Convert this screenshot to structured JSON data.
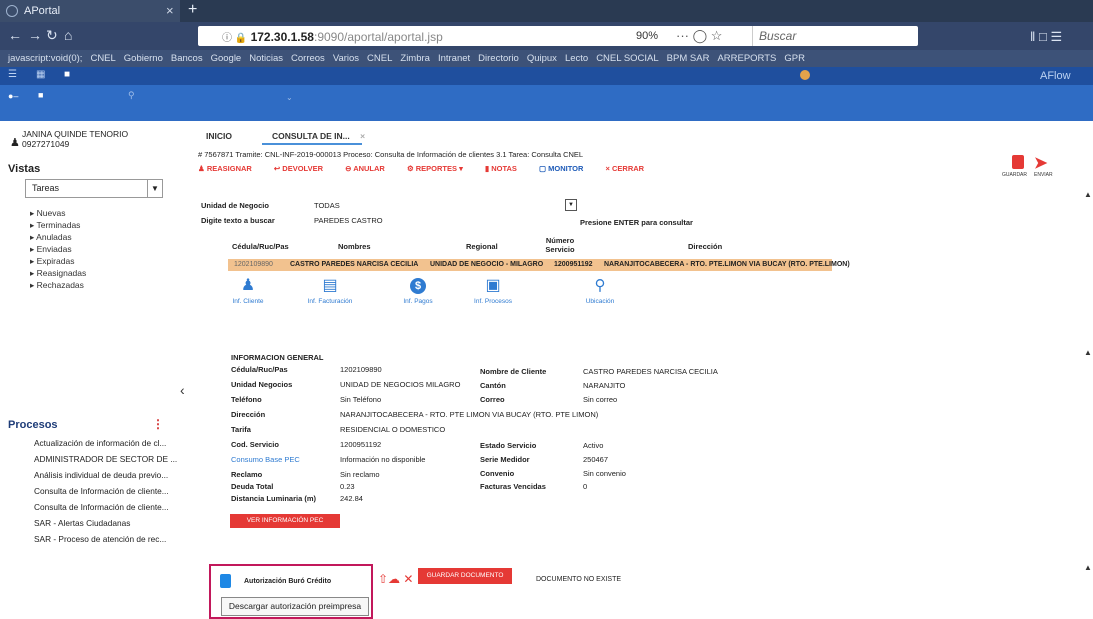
{
  "browser": {
    "tab_title": "APortal",
    "tab_close": "×",
    "new_tab": "+",
    "url_host": "172.30.1.58",
    "url_rest": ":9090/aportal/aportal.jsp",
    "zoom": "90%",
    "search_placeholder": "Buscar",
    "bookmarks": [
      "javascript:void(0);",
      "CNEL",
      "Gobierno",
      "Bancos",
      "Google",
      "Noticias",
      "Correos",
      "Varios",
      "CNEL",
      "Zimbra",
      "Intranet",
      "Directorio",
      "Quipux",
      "Lecto",
      "CNEL SOCIAL",
      "BPM SAR",
      "ARREPORTS",
      "GPR"
    ]
  },
  "app": {
    "brand": "AFlow"
  },
  "sidebar": {
    "user_name": "JANINA QUINDE TENORIO",
    "user_id": "0927271049",
    "vistas_title": "Vistas",
    "vistas_select": "Tareas",
    "vistas_items": [
      "Nuevas",
      "Terminadas",
      "Anuladas",
      "Enviadas",
      "Expiradas",
      "Reasignadas",
      "Rechazadas"
    ],
    "procesos_title": "Procesos",
    "procesos_items": [
      "Actualización de información de cl...",
      "ADMINISTRADOR DE SECTOR DE ...",
      "Análisis individual de deuda previo...",
      "Consulta de Información de cliente...",
      "Consulta de Información de cliente...",
      "SAR - Alertas Ciudadanas",
      "SAR - Proceso de atención de rec..."
    ]
  },
  "main": {
    "tab_inicio": "INICIO",
    "tab_consulta": "CONSULTA DE IN...",
    "tab_close": "×",
    "ticket": "# 7567871 Tramite: CNL-INF-2019-000013 Proceso: Consulta de Información de clientes 3.1 Tarea: Consulta CNEL",
    "actions": [
      "REASIGNAR",
      "DEVOLVER",
      "ANULAR",
      "REPORTES ▾",
      "NOTAS",
      "MONITOR",
      "CERRAR"
    ],
    "save_label": "GUARDAR",
    "send_label": "ENVIAR",
    "unidad_label": "Unidad de Negocio",
    "unidad_value": "TODAS",
    "digite_label": "Digite texto a buscar",
    "digite_value": "PAREDES CASTRO",
    "enter_hint": "Presione ENTER para consultar",
    "table_headers": [
      "Cédula/Ruc/Pas",
      "Nombres",
      "Regional",
      "Número Servicio",
      "Dirección"
    ],
    "table_row": [
      "1202109890",
      "CASTRO PAREDES NARCISA CECILIA",
      "UNIDAD DE NEGOCIO - MILAGRO",
      "1200951192",
      "NARANJITOCABECERA - RTO. PTE.LIMON VIA BUCAY (RTO. PTE.LIMON)"
    ],
    "tools": [
      "Inf. Cliente",
      "Inf. Facturación",
      "Inf. Pagos",
      "Inf. Procesos",
      "Ubicación"
    ],
    "info_title": "INFORMACION GENERAL",
    "info_left": [
      {
        "k": "Cédula/Ruc/Pas",
        "v": "1202109890"
      },
      {
        "k": "Unidad Negocios",
        "v": "UNIDAD DE NEGOCIOS MILAGRO"
      },
      {
        "k": "Teléfono",
        "v": "Sin Teléfono"
      },
      {
        "k": "Dirección",
        "v": "NARANJITOCABECERA - RTO. PTE LIMON VIA BUCAY (RTO. PTE LIMON)"
      },
      {
        "k": "Tarifa",
        "v": "RESIDENCIAL O DOMESTICO"
      },
      {
        "k": "Cod. Servicio",
        "v": "1200951192"
      },
      {
        "k": "Consumo Base PEC",
        "v": "Información no disponible"
      },
      {
        "k": "Reclamo",
        "v": "Sin reclamo"
      },
      {
        "k": "Deuda Total",
        "v": "0.23"
      },
      {
        "k": "Distancia Luminaria (m)",
        "v": "242.84"
      }
    ],
    "info_right": [
      {
        "k": "Nombre de Cliente",
        "v": "CASTRO PAREDES NARCISA CECILIA"
      },
      {
        "k": "Cantón",
        "v": "NARANJITO"
      },
      {
        "k": "Correo",
        "v": "Sin correo"
      },
      {
        "k": "Estado Servicio",
        "v": "Activo"
      },
      {
        "k": "Serie Medidor",
        "v": "250467"
      },
      {
        "k": "Convenio",
        "v": "Sin convenio"
      },
      {
        "k": "Facturas Vencidas",
        "v": "0"
      }
    ],
    "ver_pec": "VER INFORMACIÓN PEC",
    "autorizacion_label": "Autorización Buró Crédito",
    "descargar_label": "Descargar autorización preimpresa",
    "guardar_doc": "GUARDAR DOCUMENTO",
    "no_existe": "DOCUMENTO NO EXISTE"
  },
  "colors": {
    "accent": "#2f6cc4",
    "danger": "#e53935",
    "highlight": "#f2c28f"
  }
}
